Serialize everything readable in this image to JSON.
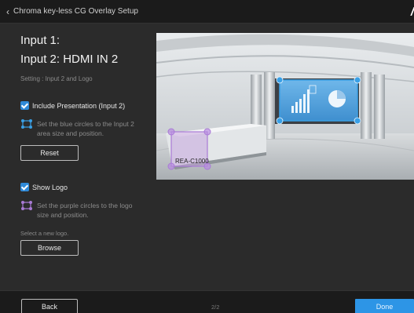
{
  "window": {
    "title": "Chroma key-less CG Overlay Setup",
    "brand_fragment": "/"
  },
  "panel": {
    "input1": "Input 1:",
    "input2": "Input 2: HDMI IN 2",
    "setting": "Setting : Input 2 and Logo",
    "presentation": {
      "checkbox_label": "Include Presentation (Input 2)",
      "checked": true,
      "hint": "Set the blue circles to the Input 2 area size and position.",
      "reset_label": "Reset"
    },
    "logo": {
      "checkbox_label": "Show Logo",
      "checked": true,
      "hint": "Set the purple circles to the logo size and position.",
      "select_label": "Select a new logo.",
      "browse_label": "Browse"
    }
  },
  "preview": {
    "logo_text": "REA-C1000"
  },
  "footer": {
    "back_label": "Back",
    "page": "2/2",
    "done_label": "Done"
  },
  "colors": {
    "accent_blue": "#2d95e6",
    "checkbox_blue": "#2f8ad8",
    "handle_blue": "#3aa0e6",
    "handle_purple": "#a97ad6"
  }
}
